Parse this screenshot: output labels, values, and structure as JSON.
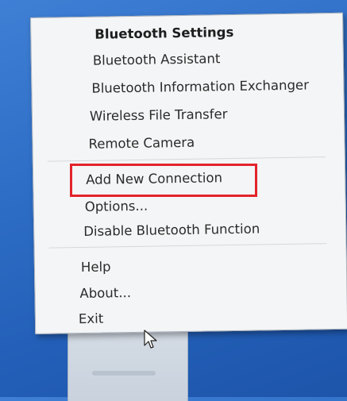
{
  "menu": {
    "items": [
      {
        "label": "Bluetooth Settings",
        "bold": true
      },
      {
        "label": "Bluetooth Assistant"
      },
      {
        "label": "Bluetooth Information Exchanger"
      },
      {
        "label": "Wireless File Transfer"
      },
      {
        "label": "Remote Camera"
      },
      {
        "label": "Add New Connection",
        "highlighted": true
      },
      {
        "label": "Options..."
      },
      {
        "label": "Disable Bluetooth Function"
      },
      {
        "label": "Help"
      },
      {
        "label": "About..."
      },
      {
        "label": "Exit"
      }
    ]
  },
  "highlight_color": "#e3232b",
  "cursor_icon": "arrow-pointer-icon"
}
